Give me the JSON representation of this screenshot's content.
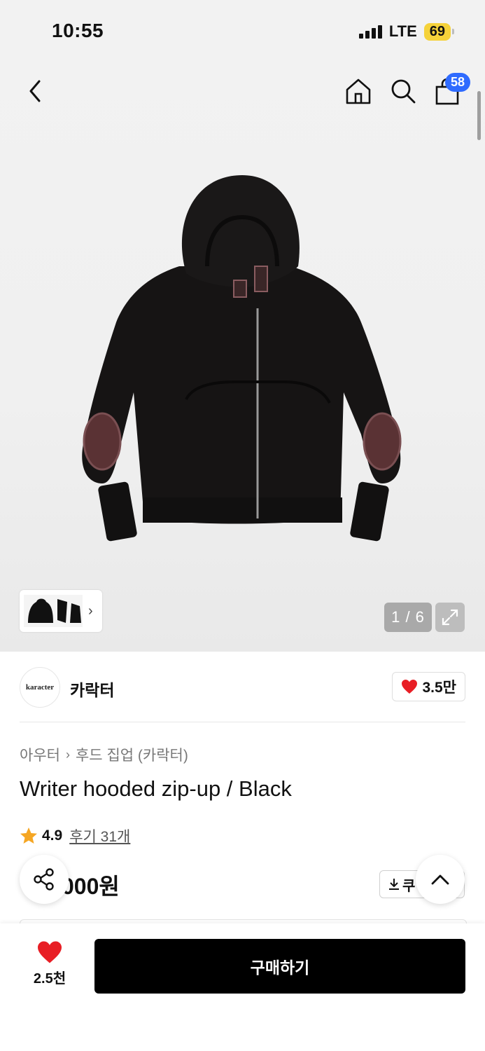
{
  "status_bar": {
    "time": "10:55",
    "network": "LTE",
    "battery": "69"
  },
  "top_nav": {
    "cart_count": "58"
  },
  "gallery": {
    "page_indicator": "1 / 6"
  },
  "brand": {
    "logo_text": "karacter",
    "name": "카락터",
    "like_count": "3.5만"
  },
  "breadcrumb": {
    "level1": "아우터",
    "level2": "후드 집업 (카락터)"
  },
  "product": {
    "title": "Writer hooded zip-up / Black",
    "rating": "4.9",
    "reviews": "후기 31개",
    "price_visible": "000원",
    "coupon_label": "쿠"
  },
  "bottom_bar": {
    "wish_count": "2.5천",
    "buy_label": "구매하기"
  },
  "colors": {
    "accent_blue": "#2f6bff",
    "heart_red": "#e81e25",
    "star_orange": "#f5a623",
    "buy_black": "#000000"
  }
}
